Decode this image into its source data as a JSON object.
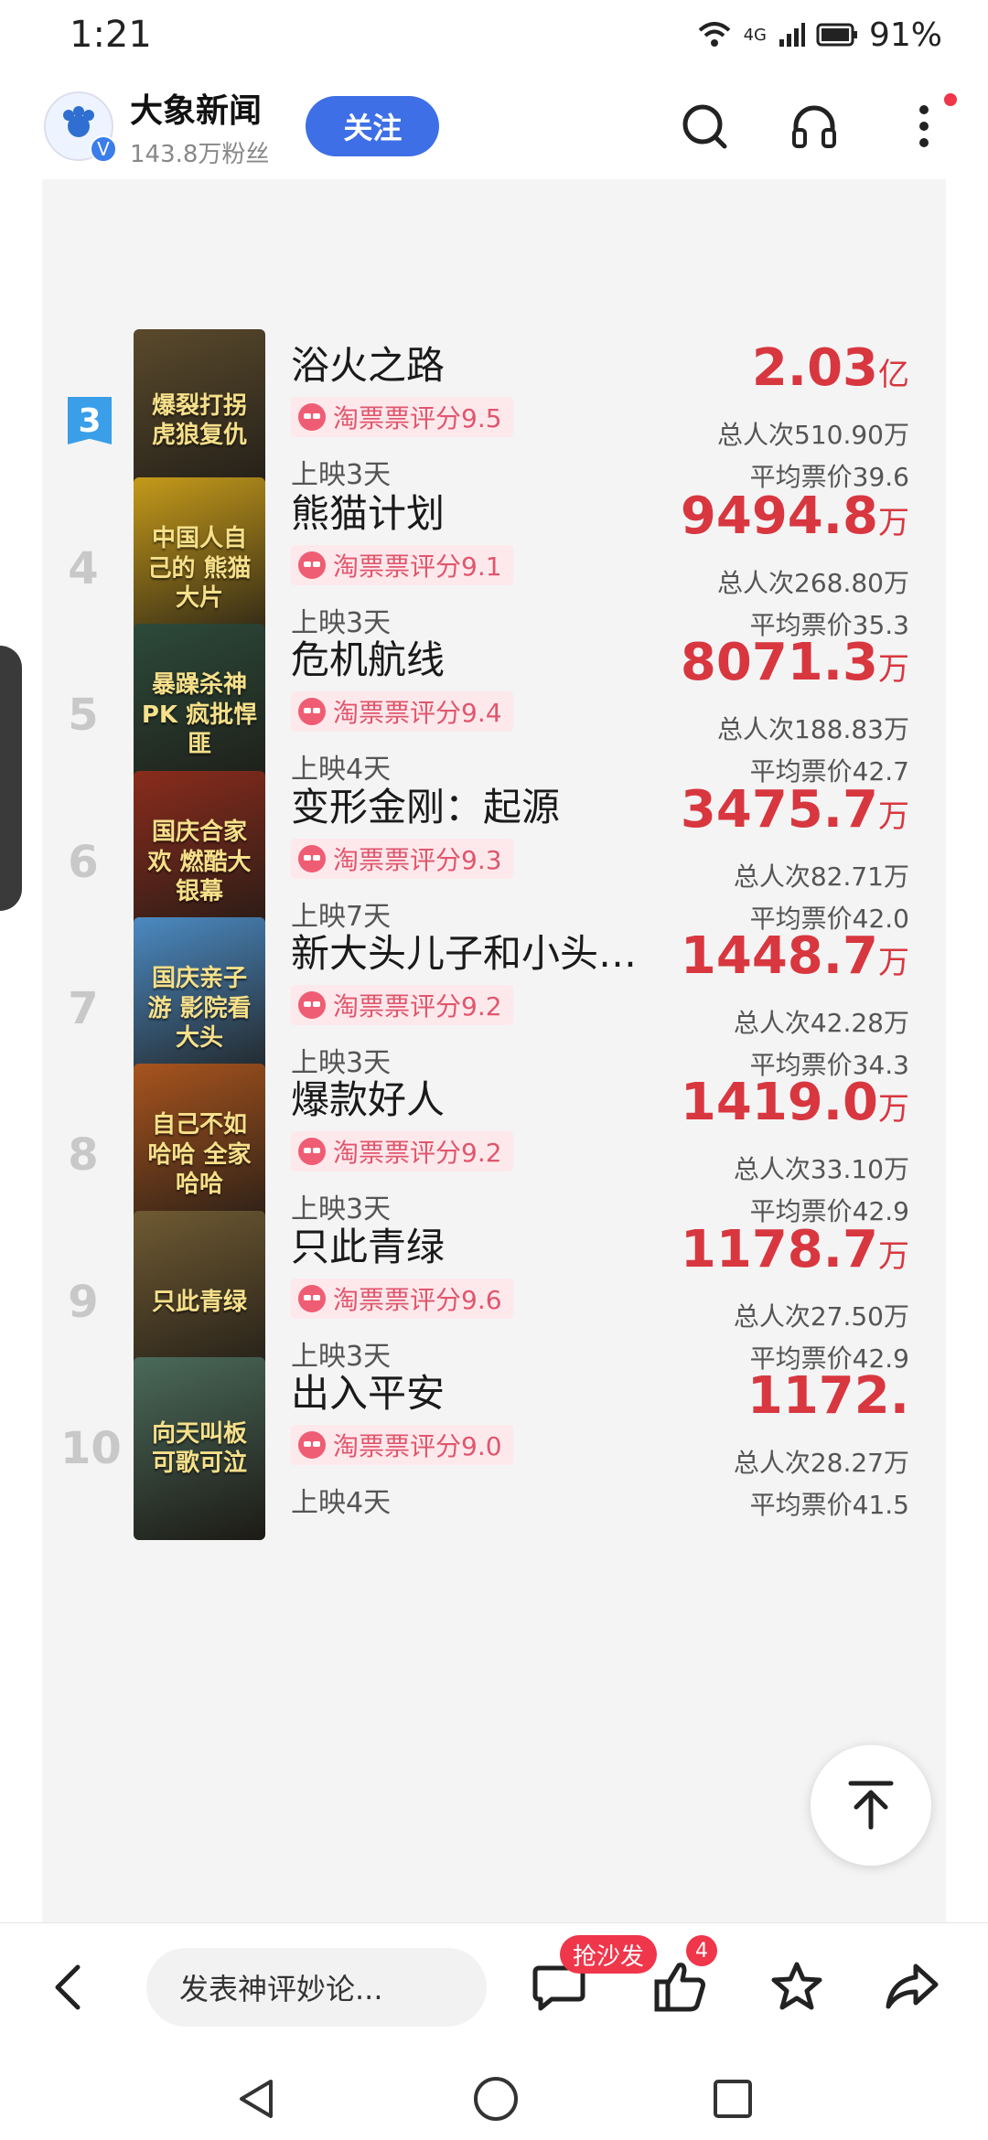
{
  "status_bar": {
    "time": "1:21",
    "network": "4G",
    "battery": "91%"
  },
  "header": {
    "publisher_name": "大象新闻",
    "fans": "143.8万粉丝",
    "follow_label": "关注",
    "avatar_text": "大象"
  },
  "partial_row": {
    "note": ""
  },
  "movies": [
    {
      "rank": "3",
      "title": "浴火之路",
      "box": "2.03",
      "unit": "亿",
      "score": "淘票票评分9.5",
      "days": "上映3天",
      "viewers": "总人次510.90万",
      "avg_price": "平均票价39.6",
      "poster_text": "爆裂打拐 虎狼复仇",
      "poster_color": "#5a4a2c"
    },
    {
      "rank": "4",
      "title": "熊猫计划",
      "box": "9494.8",
      "unit": "万",
      "score": "淘票票评分9.1",
      "days": "上映3天",
      "viewers": "总人次268.80万",
      "avg_price": "平均票价35.3",
      "poster_text": "中国人自己的 熊猫大片",
      "poster_color": "#c59a1a"
    },
    {
      "rank": "5",
      "title": "危机航线",
      "box": "8071.3",
      "unit": "万",
      "score": "淘票票评分9.4",
      "days": "上映4天",
      "viewers": "总人次188.83万",
      "avg_price": "平均票价42.7",
      "poster_text": "暴躁杀神 PK 疯批悍匪",
      "poster_color": "#2c4a3a"
    },
    {
      "rank": "6",
      "title": "变形金刚：起源",
      "box": "3475.7",
      "unit": "万",
      "score": "淘票票评分9.3",
      "days": "上映7天",
      "viewers": "总人次82.71万",
      "avg_price": "平均票价42.0",
      "poster_text": "国庆合家欢 燃酷大银幕",
      "poster_color": "#8a2c1c"
    },
    {
      "rank": "7",
      "title": "新大头儿子和小头…",
      "box": "1448.7",
      "unit": "万",
      "score": "淘票票评分9.2",
      "days": "上映3天",
      "viewers": "总人次42.28万",
      "avg_price": "平均票价34.3",
      "poster_text": "国庆亲子游 影院看大头",
      "poster_color": "#4b8ac2"
    },
    {
      "rank": "8",
      "title": "爆款好人",
      "box": "1419.0",
      "unit": "万",
      "score": "淘票票评分9.2",
      "days": "上映3天",
      "viewers": "总人次33.10万",
      "avg_price": "平均票价42.9",
      "poster_text": "自己不如哈哈 全家哈哈",
      "poster_color": "#a8541e"
    },
    {
      "rank": "9",
      "title": "只此青绿",
      "box": "1178.7",
      "unit": "万",
      "score": "淘票票评分9.6",
      "days": "上映3天",
      "viewers": "总人次27.50万",
      "avg_price": "平均票价42.9",
      "poster_text": "只此青绿",
      "poster_color": "#6f5a32"
    },
    {
      "rank": "10",
      "title": "出入平安",
      "box": "1172.",
      "unit": "",
      "score": "淘票票评分9.0",
      "days": "上映4天",
      "viewers": "总人次28.27万",
      "avg_price": "平均票价41.5",
      "poster_text": "向天叫板 可歌可泣",
      "poster_color": "#4a6a5a"
    }
  ],
  "bottom_bar": {
    "comment_placeholder": "发表神评妙论...",
    "sofa_label": "抢沙发",
    "like_count": "4"
  },
  "icons": {
    "search": "search-icon",
    "headphones": "headphones-icon",
    "more": "more-vertical-icon",
    "back": "back-arrow-icon",
    "comment": "comment-icon",
    "like": "thumbs-up-icon",
    "favorite": "star-icon",
    "share": "share-icon",
    "top": "scroll-top-icon"
  },
  "colors": {
    "accent": "#3e6fe6",
    "box_red": "#d8373f",
    "badge_blue": "#3a9ee8",
    "score_pink": "#e0566d"
  }
}
